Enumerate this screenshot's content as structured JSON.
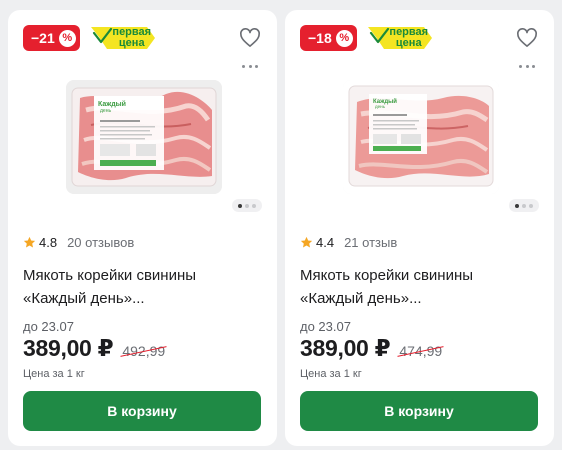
{
  "products": [
    {
      "discount": "−21",
      "discount_unit": "%",
      "first_price_label_top": "первая",
      "first_price_label_bottom": "цена",
      "rating": "4.8",
      "reviews": "20 отзывов",
      "title_line1": "Мякоть корейки свинины",
      "title_line2": "«Каждый день»...",
      "until": "до 23.07",
      "price": "389,00 ₽",
      "old_price": "492,99",
      "unit_price": "Цена за 1 кг",
      "button": "В корзину",
      "photo_brand": "Каждый день"
    },
    {
      "discount": "−18",
      "discount_unit": "%",
      "first_price_label_top": "первая",
      "first_price_label_bottom": "цена",
      "rating": "4.4",
      "reviews": "21 отзыв",
      "title_line1": "Мякоть корейки свинины",
      "title_line2": "«Каждый день»...",
      "until": "до 23.07",
      "price": "389,00 ₽",
      "old_price": "474,99",
      "unit_price": "Цена за 1 кг",
      "button": "В корзину",
      "photo_brand": "Каждый день"
    }
  ],
  "colors": {
    "discount": "#e5202e",
    "first_price_yellow": "#f4e522",
    "first_price_text": "#1a8a3a",
    "button": "#1f8a45",
    "star": "#f5a623"
  },
  "icons": {
    "favorite": "heart-icon",
    "more": "more-icon",
    "star": "star-icon"
  }
}
